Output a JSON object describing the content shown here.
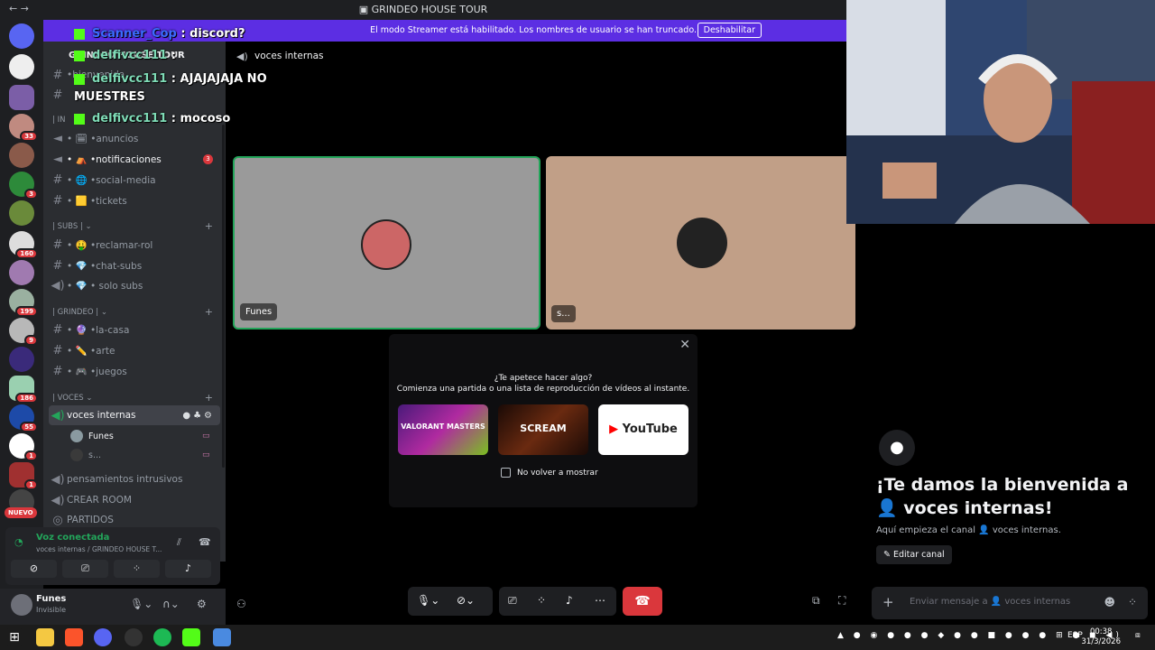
{
  "window": {
    "title": "GRINDEO HOUSE TOUR",
    "nav": "←  →"
  },
  "banner": {
    "message": "El modo Streamer está habilitado. Los nombres de usuario se han truncado.",
    "button": "Deshabilitar"
  },
  "server": {
    "name": "GRINDEO HOUSE TOUR"
  },
  "rail": {
    "badges": [
      "33",
      "3",
      "160",
      "199",
      "9",
      "186",
      "55",
      "1",
      "1"
    ],
    "new_label": "NUEVO"
  },
  "channels": {
    "top": [
      {
        "name": "•bienvenida",
        "icon": "hash"
      },
      {
        "name": "",
        "icon": "hash"
      },
      {
        "name": "| IN",
        "icon": "category"
      }
    ],
    "info": [
      {
        "name": "• 🗓 •anuncios",
        "icon": "megaphone"
      },
      {
        "name": "• ⛺ •notificaciones",
        "icon": "megaphone",
        "count": "3"
      },
      {
        "name": "• 🌐 •social-media",
        "icon": "hash"
      },
      {
        "name": "• 🟨 •tickets",
        "icon": "hash"
      }
    ],
    "subs_category": "| SUBS |",
    "subs": [
      {
        "name": "• 🤑 •reclamar-rol",
        "icon": "hash"
      },
      {
        "name": "• 💎 •chat-subs",
        "icon": "hash"
      },
      {
        "name": "• 💎 • solo subs",
        "icon": "speaker"
      }
    ],
    "grindeo_category": "| GRINDEO |",
    "grindeo": [
      {
        "name": "• 🔮 •la-casa",
        "icon": "hash"
      },
      {
        "name": "• ✏️ •arte",
        "icon": "hash"
      },
      {
        "name": "• 🎮 •juegos",
        "icon": "hash"
      }
    ],
    "voces_category": "| VOCES",
    "voice_active": "voces internas",
    "voice_members": [
      "Funes",
      "s..."
    ],
    "voice_others": [
      "pensamientos intrusivos",
      "CREAR ROOM",
      "PARTIDOS"
    ]
  },
  "voice_panel": {
    "status": "Voz conectada",
    "location": "voces internas / GRINDEO HOUSE T..."
  },
  "user": {
    "name": "Funes",
    "status": "Invisible"
  },
  "voice_header": {
    "channel": "voces internas"
  },
  "overlay_chat": [
    {
      "user": "Scanner_Cop",
      "text": ": discord?"
    },
    {
      "user": "delfivcc111",
      "text": ":"
    },
    {
      "user": "delfivcc111",
      "text": ": AJAJAJAJA NO"
    },
    {
      "user": "",
      "text": "MUESTRES"
    },
    {
      "user": "delfivcc111",
      "text": ": mocoso"
    }
  ],
  "tiles": [
    {
      "label": "Funes",
      "bg": "#9a9a9a"
    },
    {
      "label": "s...",
      "bg": "#c19f87"
    }
  ],
  "activity": {
    "question": "¿Te apetece hacer algo?",
    "description": "Comienza una partida o una lista de reproducción de vídeos al instante.",
    "items": [
      "VALORANT MASTERS",
      "SCREAM",
      "YouTube"
    ],
    "checkbox_label": "No volver a mostrar"
  },
  "right_chat": {
    "welcome": "¡Te damos la bienvenida a 👤 voces internas!",
    "info": "Aquí empieza el canal 👤 voces internas.",
    "edit": "✎ Editar canal",
    "placeholder": "Enviar mensaje a 👤 voces internas"
  },
  "taskbar": {
    "lang": "ESP",
    "time": "00:38",
    "date": "31/3/2026"
  },
  "colors": {
    "accent": "#5865f2",
    "danger": "#da373c",
    "banner": "#5c2ee3",
    "online": "#23a55a"
  }
}
